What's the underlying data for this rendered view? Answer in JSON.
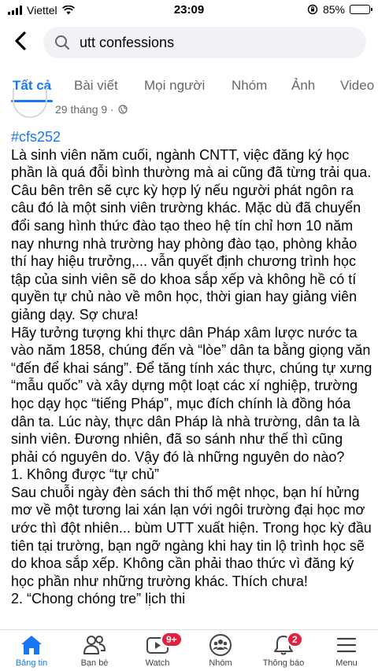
{
  "status_bar": {
    "carrier": "Viettel",
    "time": "23:09",
    "battery": "85%",
    "battery_level": 0.85
  },
  "search": {
    "query": "utt confessions"
  },
  "tabs": [
    {
      "label": "Tất cả",
      "active": true
    },
    {
      "label": "Bài viết"
    },
    {
      "label": "Mọi người"
    },
    {
      "label": "Nhóm"
    },
    {
      "label": "Ảnh"
    },
    {
      "label": "Video"
    }
  ],
  "post": {
    "date": "29 tháng 9 ·",
    "hashtag": "#cfs252",
    "paragraphs": [
      "Là sinh viên năm cuối, ngành CNTT, việc đăng ký học phần là quá đỗi bình thường mà ai cũng đã từng trải qua. Câu bên trên sẽ cực kỳ hợp lý nếu người phát ngôn ra câu đó là một sinh viên trường khác. Mặc dù đã chuyển đổi sang hình thức đào tạo theo hệ tín chỉ hơn 10 năm nay nhưng nhà trường hay phòng đào tạo, phòng khảo thí hay hiệu trưởng,... vẫn quyết định chương trình học tập của sinh viên sẽ do khoa sắp xếp và không hề có tí quyền tự chủ nào về môn học, thời gian hay giảng viên giảng dạy. Sợ chưa!",
      "Hãy tưởng tượng khi thực dân Pháp xâm lược nước ta vào năm 1858, chúng đến và “lòe” dân ta bằng giọng văn “đến để khai sáng”. Để tăng tính xác thực, chúng tự xưng “mẫu quốc” và xây dựng một loạt các xí nghiệp, trường học dạy học “tiếng Pháp”, mục đích chính là đồng hóa dân ta. Lúc này, thực dân Pháp là nhà trường, dân ta là sinh viên. Đương nhiên, đã so sánh như thế thì cũng phải có nguyên do. Vậy đó là những nguyên do nào?",
      "1. Không được “tự chủ”",
      "Sau chuỗi ngày đèn sách thi thố mệt nhọc, bạn hí hửng mơ về một tương lai xán lạn với ngôi trường đại học mơ ước thì đột nhiên... bùm UTT xuất hiện. Trong học kỳ đầu tiên tại trường, bạn ngỡ ngàng khi hay tin lộ trình học sẽ do khoa sắp xếp. Không cần phải thao thức vì đăng ký học phần như những trường khác. Thích chưa!",
      "2. “Chong chóng tre” lịch thi"
    ]
  },
  "bottom_nav": [
    {
      "label": "Bảng tin",
      "icon": "home-icon",
      "active": true
    },
    {
      "label": "Bạn bè",
      "icon": "friends-icon"
    },
    {
      "label": "Watch",
      "icon": "watch-icon",
      "badge": "9+"
    },
    {
      "label": "Nhóm",
      "icon": "groups-icon"
    },
    {
      "label": "Thông báo",
      "icon": "bell-icon",
      "badge": "2"
    },
    {
      "label": "Menu",
      "icon": "menu-icon"
    }
  ],
  "colors": {
    "accent": "#1877f2",
    "badge": "#e41e3f",
    "search_bg": "#f0f2f5",
    "muted_text": "#65676b"
  }
}
